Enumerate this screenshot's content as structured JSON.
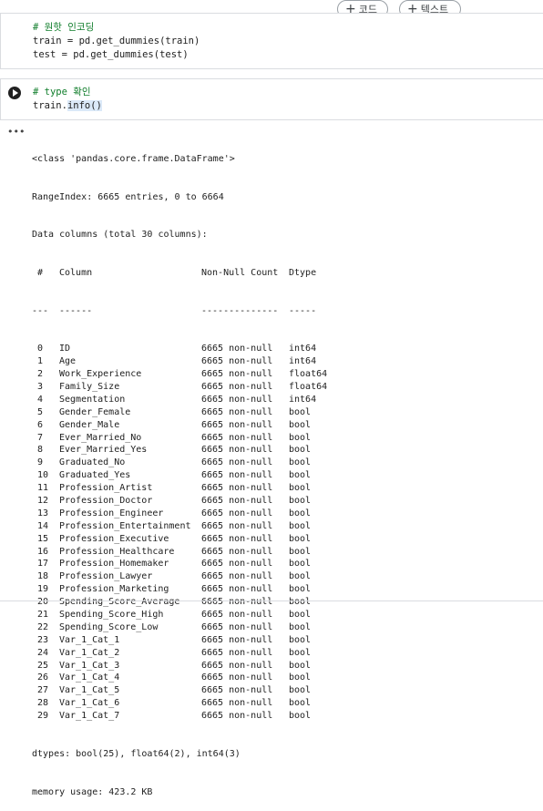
{
  "toolbar": {
    "add_code_label": "코드",
    "add_text_label": "텍스트"
  },
  "cells": [
    {
      "lines": [
        {
          "text": "# 원핫 인코딩",
          "type": "comment"
        },
        {
          "text": "train = pd.get_dummies(train)",
          "type": "code"
        },
        {
          "text": "test = pd.get_dummies(test)",
          "type": "code"
        }
      ]
    },
    {
      "comment": "# type 확인",
      "code_prefix": "train.",
      "code_highlight": "info()"
    }
  ],
  "output": {
    "menu_icon": "more-dots",
    "header": [
      "<class 'pandas.core.frame.DataFrame'>",
      "RangeIndex: 6665 entries, 0 to 6664",
      "Data columns (total 30 columns):"
    ],
    "columns_header": {
      "idx": " #",
      "col": "Column",
      "nn": "Non-Null Count",
      "dt": "Dtype"
    },
    "columns_rule": {
      "idx": "---",
      "col": "------",
      "nn": "--------------",
      "dt": "-----"
    },
    "rows": [
      {
        "idx": " 0",
        "col": "ID",
        "nn": "6665 non-null",
        "dt": "int64"
      },
      {
        "idx": " 1",
        "col": "Age",
        "nn": "6665 non-null",
        "dt": "int64"
      },
      {
        "idx": " 2",
        "col": "Work_Experience",
        "nn": "6665 non-null",
        "dt": "float64"
      },
      {
        "idx": " 3",
        "col": "Family_Size",
        "nn": "6665 non-null",
        "dt": "float64"
      },
      {
        "idx": " 4",
        "col": "Segmentation",
        "nn": "6665 non-null",
        "dt": "int64"
      },
      {
        "idx": " 5",
        "col": "Gender_Female",
        "nn": "6665 non-null",
        "dt": "bool"
      },
      {
        "idx": " 6",
        "col": "Gender_Male",
        "nn": "6665 non-null",
        "dt": "bool"
      },
      {
        "idx": " 7",
        "col": "Ever_Married_No",
        "nn": "6665 non-null",
        "dt": "bool"
      },
      {
        "idx": " 8",
        "col": "Ever_Married_Yes",
        "nn": "6665 non-null",
        "dt": "bool"
      },
      {
        "idx": " 9",
        "col": "Graduated_No",
        "nn": "6665 non-null",
        "dt": "bool"
      },
      {
        "idx": " 10",
        "col": "Graduated_Yes",
        "nn": "6665 non-null",
        "dt": "bool"
      },
      {
        "idx": " 11",
        "col": "Profession_Artist",
        "nn": "6665 non-null",
        "dt": "bool"
      },
      {
        "idx": " 12",
        "col": "Profession_Doctor",
        "nn": "6665 non-null",
        "dt": "bool"
      },
      {
        "idx": " 13",
        "col": "Profession_Engineer",
        "nn": "6665 non-null",
        "dt": "bool"
      },
      {
        "idx": " 14",
        "col": "Profession_Entertainment",
        "nn": "6665 non-null",
        "dt": "bool"
      },
      {
        "idx": " 15",
        "col": "Profession_Executive",
        "nn": "6665 non-null",
        "dt": "bool"
      },
      {
        "idx": " 16",
        "col": "Profession_Healthcare",
        "nn": "6665 non-null",
        "dt": "bool"
      },
      {
        "idx": " 17",
        "col": "Profession_Homemaker",
        "nn": "6665 non-null",
        "dt": "bool"
      },
      {
        "idx": " 18",
        "col": "Profession_Lawyer",
        "nn": "6665 non-null",
        "dt": "bool"
      },
      {
        "idx": " 19",
        "col": "Profession_Marketing",
        "nn": "6665 non-null",
        "dt": "bool"
      },
      {
        "idx": " 20",
        "col": "Spending_Score_Average",
        "nn": "6665 non-null",
        "dt": "bool"
      },
      {
        "idx": " 21",
        "col": "Spending_Score_High",
        "nn": "6665 non-null",
        "dt": "bool"
      },
      {
        "idx": " 22",
        "col": "Spending_Score_Low",
        "nn": "6665 non-null",
        "dt": "bool"
      },
      {
        "idx": " 23",
        "col": "Var_1_Cat_1",
        "nn": "6665 non-null",
        "dt": "bool"
      },
      {
        "idx": " 24",
        "col": "Var_1_Cat_2",
        "nn": "6665 non-null",
        "dt": "bool"
      },
      {
        "idx": " 25",
        "col": "Var_1_Cat_3",
        "nn": "6665 non-null",
        "dt": "bool"
      },
      {
        "idx": " 26",
        "col": "Var_1_Cat_4",
        "nn": "6665 non-null",
        "dt": "bool"
      },
      {
        "idx": " 27",
        "col": "Var_1_Cat_5",
        "nn": "6665 non-null",
        "dt": "bool"
      },
      {
        "idx": " 28",
        "col": "Var_1_Cat_6",
        "nn": "6665 non-null",
        "dt": "bool"
      },
      {
        "idx": " 29",
        "col": "Var_1_Cat_7",
        "nn": "6665 non-null",
        "dt": "bool"
      }
    ],
    "footer": [
      "dtypes: bool(25), float64(2), int64(3)",
      "memory usage: 423.2 KB"
    ]
  }
}
